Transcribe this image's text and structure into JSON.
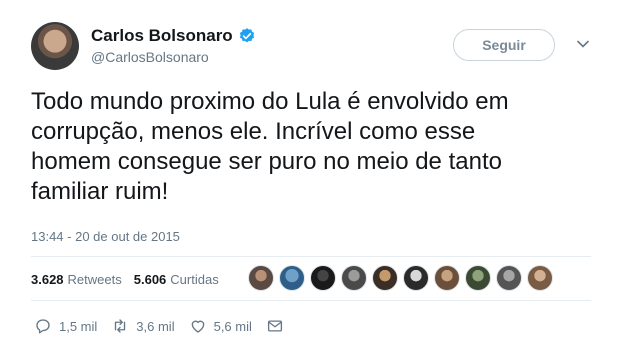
{
  "author": {
    "display_name": "Carlos Bolsonaro",
    "handle": "@CarlosBolsonaro",
    "verified": true
  },
  "follow_button": {
    "label": "Seguir"
  },
  "tweet": {
    "text": "Todo mundo proximo do Lula é envolvido em\ncorrupção, menos ele. Incrível como esse\nhomem consegue ser puro no meio de tanto\nfamiliar ruim!",
    "timestamp": "13:44 - 20 de out de 2015"
  },
  "stats": {
    "retweets_count": "3.628",
    "retweets_label": "Retweets",
    "likes_count": "5.606",
    "likes_label": "Curtidas"
  },
  "liker_avatars": 10,
  "actions": {
    "replies": "1,5 mil",
    "retweets": "3,6 mil",
    "likes": "5,6 mil"
  },
  "colors": {
    "verified": "#1da1f2",
    "secondary_text": "#657786",
    "border": "#e6ecf0"
  }
}
